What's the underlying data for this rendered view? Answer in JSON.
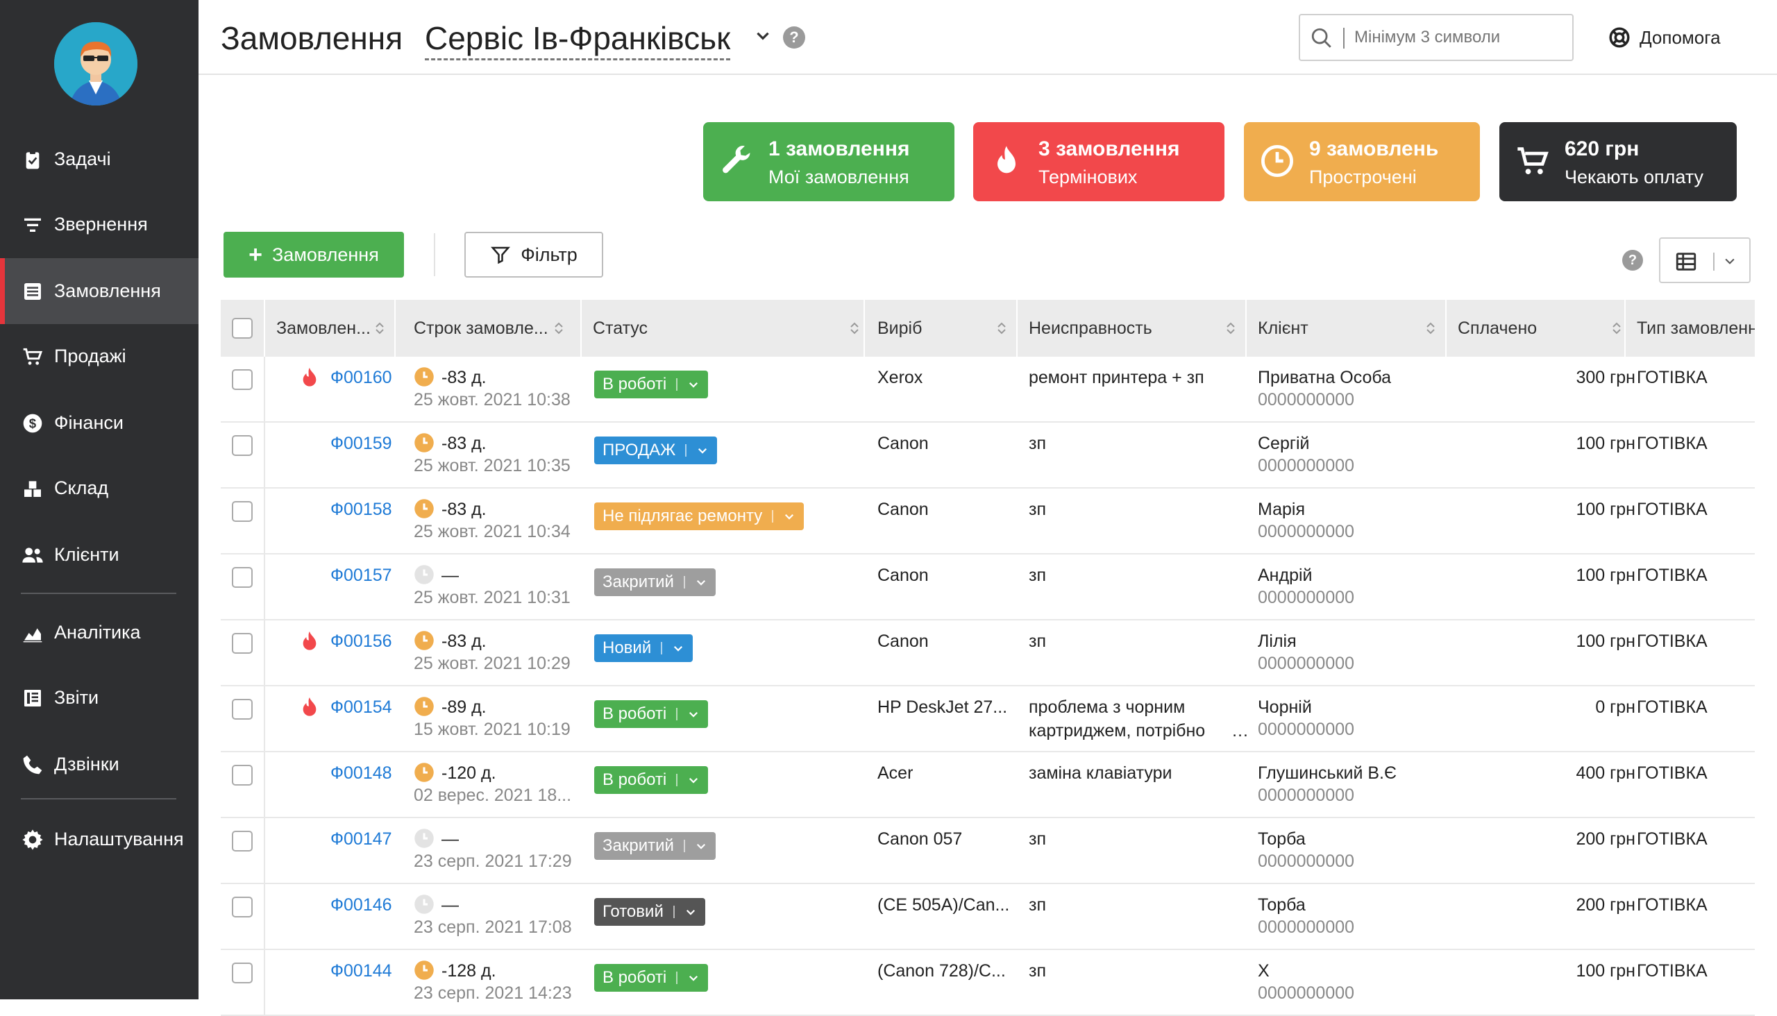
{
  "sidebar": {
    "items": [
      {
        "label": "Задачі",
        "icon": "tasks-icon"
      },
      {
        "label": "Звернення",
        "icon": "filter-lines-icon"
      },
      {
        "label": "Замовлення",
        "icon": "orders-icon",
        "active": true
      },
      {
        "label": "Продажі",
        "icon": "cart-icon"
      },
      {
        "label": "Фінанси",
        "icon": "dollar-icon"
      },
      {
        "label": "Склад",
        "icon": "warehouse-icon"
      },
      {
        "label": "Клієнти",
        "icon": "users-icon"
      },
      {
        "label": "Аналітика",
        "icon": "chart-area-icon"
      },
      {
        "label": "Звіти",
        "icon": "reports-icon"
      },
      {
        "label": "Дзвінки",
        "icon": "phone-icon"
      },
      {
        "label": "Налаштування",
        "icon": "gear-icon"
      }
    ]
  },
  "header": {
    "title": "Замовлення",
    "service": "Сервіс Ів-Франківськ",
    "search_placeholder": "Мінімум 3 символи",
    "help_label": "Допомога"
  },
  "summary": {
    "mine": {
      "line1": "1 замовлення",
      "line2": "Мої замовлення",
      "color": "#4caf50"
    },
    "urgent": {
      "line1": "3 замовлення",
      "line2": "Термінових",
      "color": "#f2484b"
    },
    "overdue": {
      "line1": "9 замовлень",
      "line2": "Прострочені",
      "color": "#f0ad4e"
    },
    "unpaid": {
      "line1": "620 грн",
      "line2": "Чекають оплату",
      "color": "#2e2f31"
    }
  },
  "toolbar": {
    "add_label": "Замовлення",
    "filter_label": "Фільтр"
  },
  "table": {
    "headers": [
      "Замовлен...",
      "Строк замовле...",
      "Статус",
      "Виріб",
      "Неисправность",
      "Клієнт",
      "Сплачено",
      "Тип замовлення"
    ],
    "rows": [
      {
        "urgent": true,
        "id": "Ф00160",
        "clock": "orange",
        "days": "-83 д.",
        "date": "25 жовт. 2021 10:38",
        "status": "В роботі",
        "status_color": "#4caf50",
        "product": "Xerox",
        "fault": "ремонт принтера + зп",
        "fault2": "",
        "client": "Приватна Особа",
        "phone": "0000000000",
        "paid": "300 грн",
        "type": "ГОТІВКА"
      },
      {
        "urgent": false,
        "id": "Ф00159",
        "clock": "orange",
        "days": "-83 д.",
        "date": "25 жовт. 2021 10:35",
        "status": "ПРОДАЖ",
        "status_color": "#2d8fd5",
        "product": "Canon",
        "fault": "зп",
        "fault2": "",
        "client": "Сергій",
        "phone": "0000000000",
        "paid": "100 грн",
        "type": "ГОТІВКА"
      },
      {
        "urgent": false,
        "id": "Ф00158",
        "clock": "orange",
        "days": "-83 д.",
        "date": "25 жовт. 2021 10:34",
        "status": "Не підлягає ремонту",
        "status_color": "#f0ad4e",
        "product": "Canon",
        "fault": "зп",
        "fault2": "",
        "client": "Марія",
        "phone": "0000000000",
        "paid": "100 грн",
        "type": "ГОТІВКА"
      },
      {
        "urgent": false,
        "id": "Ф00157",
        "clock": "grey",
        "days": "—",
        "date": "25 жовт. 2021 10:31",
        "status": "Закритий",
        "status_color": "#9e9e9e",
        "product": "Canon",
        "fault": "зп",
        "fault2": "",
        "client": "Андрій",
        "phone": "0000000000",
        "paid": "100 грн",
        "type": "ГОТІВКА"
      },
      {
        "urgent": true,
        "id": "Ф00156",
        "clock": "orange",
        "days": "-83 д.",
        "date": "25 жовт. 2021 10:29",
        "status": "Новий",
        "status_color": "#2d8fd5",
        "product": "Canon",
        "fault": "зп",
        "fault2": "",
        "client": "Лілія",
        "phone": "0000000000",
        "paid": "100 грн",
        "type": "ГОТІВКА"
      },
      {
        "urgent": true,
        "id": "Ф00154",
        "clock": "orange",
        "days": "-89 д.",
        "date": "15 жовт. 2021 10:19",
        "status": "В роботі",
        "status_color": "#4caf50",
        "product": "HP DeskJet 27...",
        "fault": "проблема з чорним",
        "fault2": "картриджем, потрібно",
        "client": "Чорній",
        "phone": "0000000000",
        "paid": "0 грн",
        "type": "ГОТІВКА"
      },
      {
        "urgent": false,
        "id": "Ф00148",
        "clock": "orange",
        "days": "-120 д.",
        "date": "02 верес. 2021 18...",
        "status": "В роботі",
        "status_color": "#4caf50",
        "product": "Acer",
        "fault": "заміна клавіатури",
        "fault2": "",
        "client": "Глушинський В.Є",
        "phone": "0000000000",
        "paid": "400 грн",
        "type": "ГОТІВКА"
      },
      {
        "urgent": false,
        "id": "Ф00147",
        "clock": "grey",
        "days": "—",
        "date": "23 серп. 2021 17:29",
        "status": "Закритий",
        "status_color": "#9e9e9e",
        "product": "Canon 057",
        "fault": "зп",
        "fault2": "",
        "client": "Торба",
        "phone": "0000000000",
        "paid": "200 грн",
        "type": "ГОТІВКА"
      },
      {
        "urgent": false,
        "id": "Ф00146",
        "clock": "grey",
        "days": "—",
        "date": "23 серп. 2021 17:08",
        "status": "Готовий",
        "status_color": "#555555",
        "product": "(CE 505A)/Can...",
        "fault": "зп",
        "fault2": "",
        "client": "Торба",
        "phone": "0000000000",
        "paid": "200 грн",
        "type": "ГОТІВКА"
      },
      {
        "urgent": false,
        "id": "Ф00144",
        "clock": "orange",
        "days": "-128 д.",
        "date": "23 серп. 2021 14:23",
        "status": "В роботі",
        "status_color": "#4caf50",
        "product": "(Canon 728)/C...",
        "fault": "зп",
        "fault2": "",
        "client": "Х",
        "phone": "0000000000",
        "paid": "100 грн",
        "type": "ГОТІВКА"
      }
    ]
  }
}
